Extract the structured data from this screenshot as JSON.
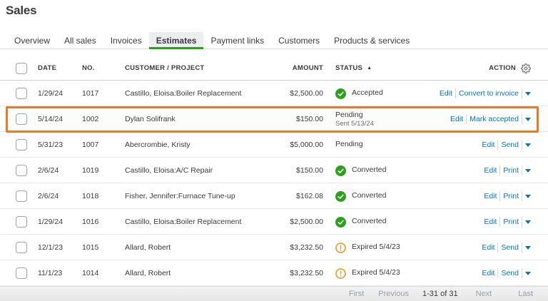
{
  "page": {
    "title": "Sales"
  },
  "tabs": [
    {
      "label": "Overview",
      "active": false
    },
    {
      "label": "All sales",
      "active": false
    },
    {
      "label": "Invoices",
      "active": false
    },
    {
      "label": "Estimates",
      "active": true
    },
    {
      "label": "Payment links",
      "active": false
    },
    {
      "label": "Customers",
      "active": false
    },
    {
      "label": "Products & services",
      "active": false
    }
  ],
  "table": {
    "headers": {
      "date": "DATE",
      "no": "NO.",
      "customer": "CUSTOMER / PROJECT",
      "amount": "AMOUNT",
      "status": "STATUS",
      "action": "ACTION"
    },
    "sort_icon": "▲",
    "rows": [
      {
        "date": "1/29/24",
        "no": "1017",
        "customer": "Castillo, Eloisa:Boiler Replacement",
        "amount": "$2,500.00",
        "status": "Accepted",
        "status_sub": "",
        "status_icon": "check",
        "actions": [
          "Edit",
          "Convert to invoice"
        ],
        "highlighted": false
      },
      {
        "date": "5/14/24",
        "no": "1002",
        "customer": "Dylan Solifrank",
        "amount": "$150.00",
        "status": "Pending",
        "status_sub": "Sent 5/13/24",
        "status_icon": "none",
        "actions": [
          "Edit",
          "Mark accepted"
        ],
        "highlighted": true
      },
      {
        "date": "5/31/23",
        "no": "1007",
        "customer": "Abercrombie, Kristy",
        "amount": "$5,000.00",
        "status": "Pending",
        "status_sub": "",
        "status_icon": "none",
        "actions": [
          "Edit",
          "Send"
        ],
        "highlighted": false
      },
      {
        "date": "2/6/24",
        "no": "1019",
        "customer": "Castillo, Eloisa:A/C Repair",
        "amount": "$150.00",
        "status": "Converted",
        "status_sub": "",
        "status_icon": "check",
        "actions": [
          "Edit",
          "Print"
        ],
        "highlighted": false
      },
      {
        "date": "2/6/24",
        "no": "1018",
        "customer": "Fisher, Jennifer:Furnace Tune-up",
        "amount": "$162.08",
        "status": "Converted",
        "status_sub": "",
        "status_icon": "check",
        "actions": [
          "Edit",
          "Print"
        ],
        "highlighted": false
      },
      {
        "date": "1/29/24",
        "no": "1016",
        "customer": "Castillo, Eloisa:Boiler Replacement",
        "amount": "$2,500.00",
        "status": "Converted",
        "status_sub": "",
        "status_icon": "check",
        "actions": [
          "Edit",
          "Print"
        ],
        "highlighted": false
      },
      {
        "date": "12/1/23",
        "no": "1015",
        "customer": "Allard, Robert",
        "amount": "$3,232.50",
        "status": "Expired 5/4/23",
        "status_sub": "",
        "status_icon": "warning",
        "actions": [
          "Edit",
          "Send"
        ],
        "highlighted": false
      },
      {
        "date": "11/1/23",
        "no": "1014",
        "customer": "Allard, Robert",
        "amount": "$3,232.50",
        "status": "Expired 5/4/23",
        "status_sub": "",
        "status_icon": "warning",
        "actions": [
          "Edit",
          "Send"
        ],
        "highlighted": false
      }
    ]
  },
  "pagination": {
    "first": "First",
    "previous": "Previous",
    "range": "1-31 of 31",
    "next": "Next",
    "last": "Last"
  },
  "colors": {
    "brand_green": "#2CA01C",
    "link_blue": "#0077C5",
    "highlight_orange": "#E87B30",
    "warning_amber": "#E9A23B",
    "text": "#393A3D"
  }
}
